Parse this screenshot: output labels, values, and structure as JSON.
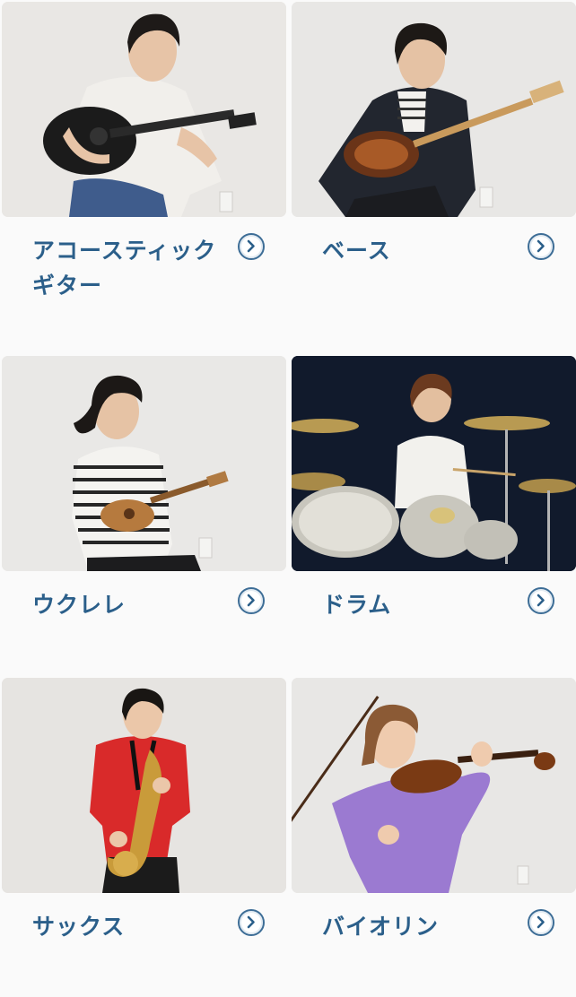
{
  "instruments": [
    {
      "label": "アコースティック\nギター",
      "photo_subject": "acoustic-guitar-player"
    },
    {
      "label": "ベース",
      "photo_subject": "bass-player"
    },
    {
      "label": "ウクレレ",
      "photo_subject": "ukulele-player"
    },
    {
      "label": "ドラム",
      "photo_subject": "drum-player"
    },
    {
      "label": "サックス",
      "photo_subject": "saxophone-player"
    },
    {
      "label": "バイオリン",
      "photo_subject": "violin-player"
    }
  ],
  "icons": {
    "chevron": "chevron-right-circle-icon"
  },
  "colors": {
    "label": "#2b5f8a",
    "chevron": "#3d6d96",
    "background": "#fafafa"
  }
}
